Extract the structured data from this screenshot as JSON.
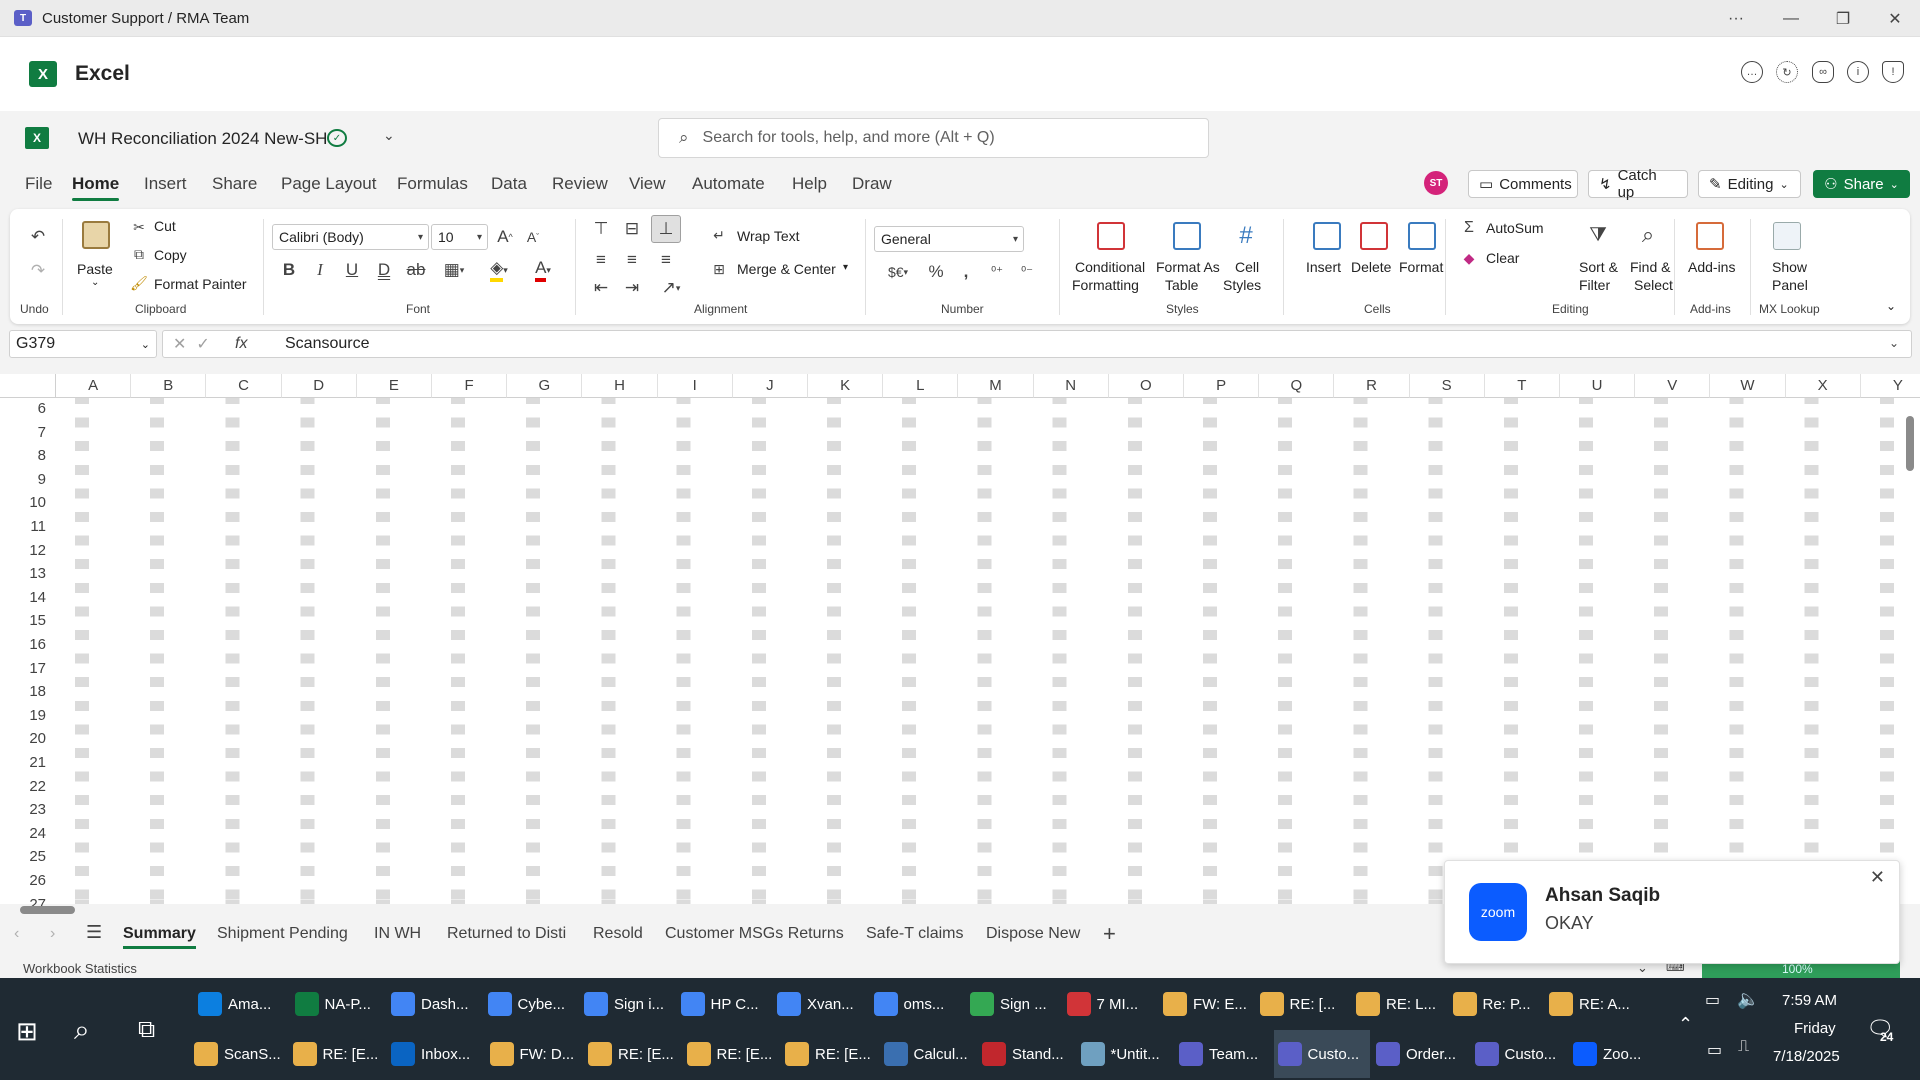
{
  "window": {
    "title": "Customer Support / RMA Team"
  },
  "app": {
    "name": "Excel"
  },
  "document": {
    "name": "WH Reconciliation 2024 New-SH"
  },
  "search": {
    "placeholder": "Search for tools, help, and more (Alt + Q)"
  },
  "menu_tabs": [
    "File",
    "Home",
    "Insert",
    "Share",
    "Page Layout",
    "Formulas",
    "Data",
    "Review",
    "View",
    "Automate",
    "Help",
    "Draw"
  ],
  "user": {
    "initials": "ST"
  },
  "top_buttons": {
    "comments": "Comments",
    "catch_up": "Catch up",
    "editing": "Editing",
    "share": "Share"
  },
  "ribbon": {
    "undo_group": "Undo",
    "clipboard": {
      "paste": "Paste",
      "cut": "Cut",
      "copy": "Copy",
      "format_painter": "Format Painter",
      "label": "Clipboard"
    },
    "font": {
      "name": "Calibri (Body)",
      "size": "10",
      "label": "Font"
    },
    "alignment": {
      "wrap_text": "Wrap Text",
      "merge_center": "Merge & Center",
      "label": "Alignment"
    },
    "number": {
      "format": "General",
      "label": "Number"
    },
    "styles": {
      "conditional_1": "Conditional",
      "conditional_2": "Formatting",
      "format_as_1": "Format As",
      "format_as_2": "Table",
      "cell_1": "Cell",
      "cell_2": "Styles",
      "label": "Styles"
    },
    "cells": {
      "insert": "Insert",
      "delete": "Delete",
      "format": "Format",
      "label": "Cells"
    },
    "editing": {
      "autosum": "AutoSum",
      "clear": "Clear",
      "sort_1": "Sort &",
      "sort_2": "Filter",
      "find_1": "Find &",
      "find_2": "Select",
      "label": "Editing"
    },
    "addins": {
      "button": "Add-ins",
      "label": "Add-ins"
    },
    "mx": {
      "show_1": "Show",
      "show_2": "Panel",
      "label": "MX Lookup"
    }
  },
  "formula_bar": {
    "cell_ref": "G379",
    "fx": "fx",
    "content": "Scansource"
  },
  "columns": [
    "A",
    "B",
    "C",
    "D",
    "E",
    "F",
    "G",
    "H",
    "I",
    "J",
    "K",
    "L",
    "M",
    "N",
    "O",
    "P",
    "Q",
    "R",
    "S",
    "T",
    "U",
    "V",
    "W",
    "X",
    "Y"
  ],
  "rows": [
    "6",
    "7",
    "8",
    "9",
    "10",
    "11",
    "12",
    "13",
    "14",
    "15",
    "16",
    "17",
    "18",
    "19",
    "20",
    "21",
    "22",
    "23",
    "24",
    "25",
    "26",
    "27"
  ],
  "sheet_tabs": [
    "Summary",
    "Shipment Pending",
    "IN WH",
    "Returned to Disti",
    "Resold",
    "Customer MSGs Returns",
    "Safe-T claims",
    "Dispose New"
  ],
  "status": {
    "left": "Workbook Statistics",
    "zoom": "100%"
  },
  "toast": {
    "sender": "Ahsan Saqib",
    "message": "OKAY",
    "logo": "zoom"
  },
  "taskbar": {
    "row1": [
      "Ama...",
      "NA-P...",
      "Dash...",
      "Cybe...",
      "Sign i...",
      "HP C...",
      "Xvan...",
      "oms...",
      "Sign ...",
      "7 MI...",
      "FW: E...",
      "RE: [...",
      "RE: L...",
      "Re: P...",
      "RE: A..."
    ],
    "row2": [
      "ScanS...",
      "RE: [E...",
      "Inbox...",
      "FW: D...",
      "RE: [E...",
      "RE: [E...",
      "RE: [E...",
      "Calcul...",
      "Stand...",
      "*Untit...",
      "Team...",
      "Custo...",
      "Order...",
      "Custo...",
      "Zoo..."
    ],
    "time": "7:59 AM",
    "day": "Friday",
    "date": "7/18/2025",
    "notif_count": "24"
  }
}
